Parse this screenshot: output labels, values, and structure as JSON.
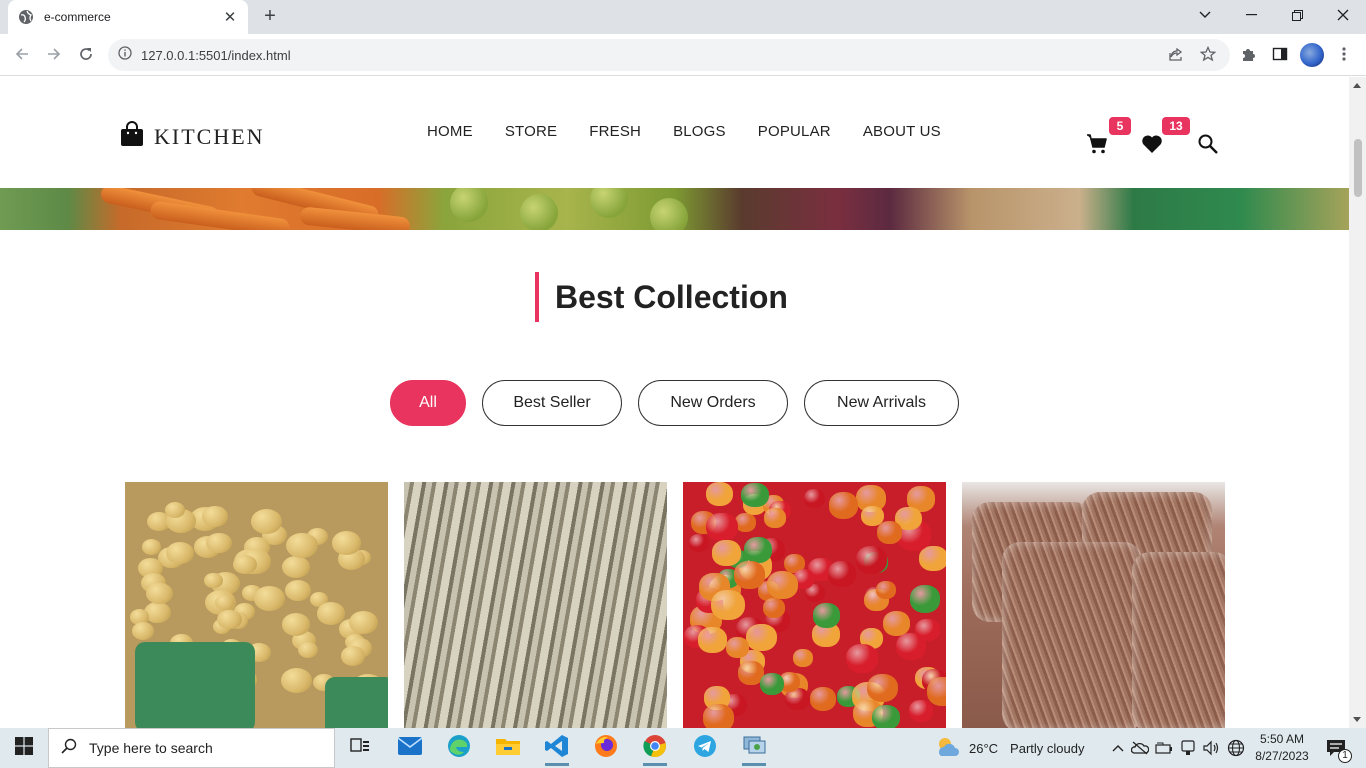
{
  "browser": {
    "tab_title": "e-commerce",
    "url": "127.0.0.1:5501/index.html"
  },
  "site": {
    "logo_text": "KITCHEN",
    "nav": [
      "HOME",
      "STORE",
      "FRESH",
      "BLOGS",
      "POPULAR",
      "ABOUT US"
    ],
    "cart_count": "5",
    "wishlist_count": "13",
    "accent_color": "#e8345e"
  },
  "collection": {
    "title": "Best Collection",
    "filters": [
      {
        "label": "All",
        "active": true
      },
      {
        "label": "Best Seller",
        "active": false
      },
      {
        "label": "New Orders",
        "active": false
      },
      {
        "label": "New Arrivals",
        "active": false
      }
    ],
    "products": [
      "potatoes",
      "dried-fish",
      "peppers",
      "rice-bags"
    ]
  },
  "taskbar": {
    "search_placeholder": "Type here to search",
    "weather_temp": "26°C",
    "weather_desc": "Partly cloudy",
    "time": "5:50 AM",
    "date": "8/27/2023",
    "notification_count": "1"
  }
}
